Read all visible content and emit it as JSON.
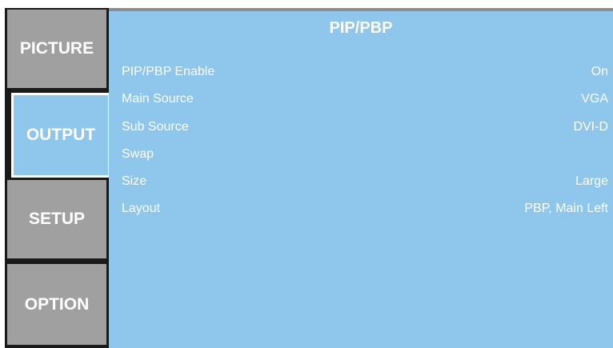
{
  "tabs": [
    {
      "label": "PICTURE",
      "active": false
    },
    {
      "label": "OUTPUT",
      "active": true
    },
    {
      "label": "SETUP",
      "active": false
    },
    {
      "label": "OPTION",
      "active": false
    }
  ],
  "panel": {
    "title": "PIP/PBP",
    "rows": [
      {
        "label": "PIP/PBP Enable",
        "value": "On"
      },
      {
        "label": "Main Source",
        "value": "VGA"
      },
      {
        "label": "Sub Source",
        "value": "DVI-D"
      },
      {
        "label": "Swap",
        "value": ""
      },
      {
        "label": "Size",
        "value": "Large"
      },
      {
        "label": "Layout",
        "value": "PBP, Main Left"
      }
    ]
  },
  "colors": {
    "panel_bg": "#8ec6ec",
    "tab_inactive_bg": "#a0a0a0",
    "frame": "#1a1a1a",
    "text": "#ffffff"
  }
}
